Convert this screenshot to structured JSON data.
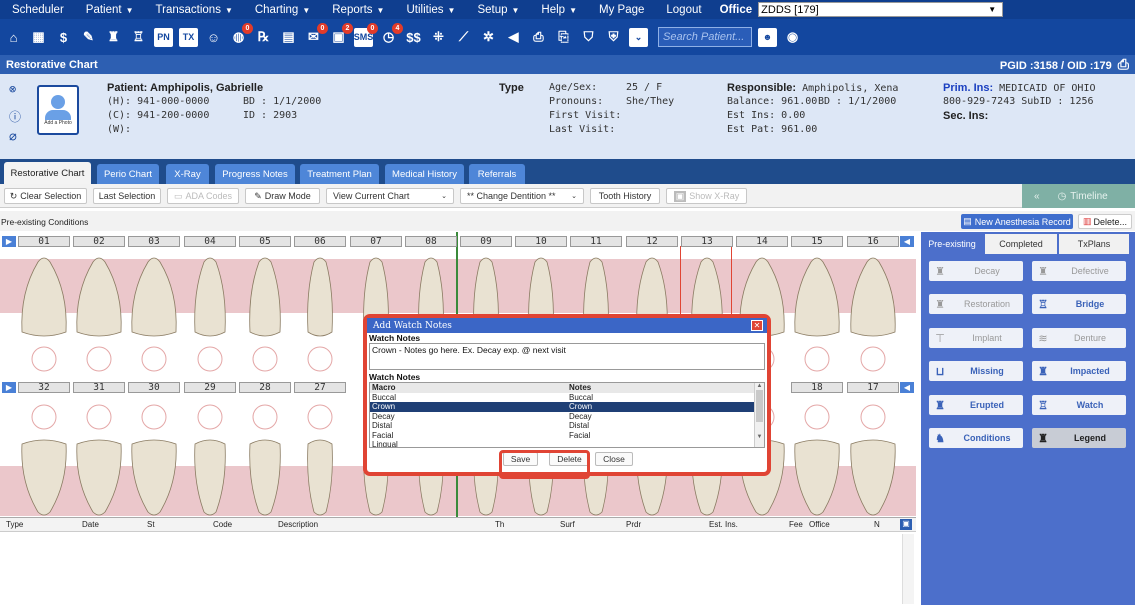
{
  "menubar": {
    "items": [
      "Scheduler",
      "Patient",
      "Transactions",
      "Charting",
      "Reports",
      "Utilities",
      "Setup",
      "Help",
      "My Page",
      "Logout"
    ],
    "office_label": "Office",
    "office_value": "ZDDS [179]"
  },
  "iconbar": {
    "search_placeholder": "Search Patient...",
    "icons": [
      "home-icon",
      "calendar-icon",
      "dollar-icon",
      "pen-icon",
      "tooth-icon",
      "tooth-alt-icon",
      "pn-icon",
      "tx-icon",
      "users-icon",
      "globe-icon",
      "rx-icon",
      "chat-icon",
      "message-icon",
      "ab-icon",
      "sms-icon",
      "clock-icon",
      "money-icon",
      "grid-icon",
      "chart-icon",
      "network-icon",
      "megaphone-icon",
      "printer-icon",
      "print-icon",
      "shield-check-icon",
      "shield-icon",
      "chevron-icon",
      "user-search-icon",
      "eye-search-icon"
    ],
    "badges": {
      "globe": "0",
      "rx": "0",
      "ab": "2",
      "sms": "0",
      "clock": "4"
    }
  },
  "titlebar": {
    "title": "Restorative Chart",
    "ids": "PGID :3158 / OID :179"
  },
  "patient": {
    "name_label": "Patient:",
    "name": "Amphipolis, Gabrielle",
    "home": "(H): 941-000-0000",
    "bd": "BD : 1/1/2000",
    "cell": "(C): 941-200-0000",
    "id": "ID : 2903",
    "work": "(W):",
    "add_photo": "Add a Photo",
    "type_label": "Type",
    "age_label": "Age/Sex:",
    "age_value": "25 / F",
    "pron_label": "Pronouns:",
    "pron_value": "She/They",
    "first_label": "First Visit:",
    "last_label": "Last Visit:",
    "resp_label": "Responsible:",
    "resp_name": "Amphipolis, Xena",
    "balance": "Balance: 961.00",
    "resp_bd": "BD : 1/1/2000",
    "est_ins": "Est Ins:  0.00",
    "est_pat": "Est Pat: 961.00",
    "prim_label": "Prim. Ins:",
    "prim_value": "MEDICAID OF OHIO",
    "prim_phone": "800-929-7243 SubID : 1256",
    "sec_label": "Sec. Ins:"
  },
  "tabs": [
    "Restorative Chart",
    "Perio Chart",
    "X-Ray",
    "Progress Notes",
    "Treatment Plan",
    "Medical History",
    "Referrals"
  ],
  "toolbar": {
    "clear": "Clear Selection",
    "last": "Last Selection",
    "ada": "ADA Codes",
    "draw": "Draw Mode",
    "view": "View Current Chart",
    "dentition": "** Change Dentition **",
    "history": "Tooth History",
    "xray": "Show X-Ray",
    "timeline": "Timeline"
  },
  "condbar": {
    "title": "Pre-existing Conditions",
    "anesthesia": "New Anesthesia Record",
    "delete": "Delete..."
  },
  "teeth_upper": [
    "01",
    "02",
    "03",
    "04",
    "05",
    "06",
    "07",
    "08",
    "09",
    "10",
    "11",
    "12",
    "13",
    "14",
    "15",
    "16"
  ],
  "teeth_lower": [
    "32",
    "31",
    "30",
    "29",
    "28",
    "27",
    "18",
    "17"
  ],
  "side": {
    "tabs": [
      "Pre-existing",
      "Completed",
      "TxPlans"
    ],
    "buttons": [
      "Decay",
      "Defective",
      "Restoration",
      "Bridge",
      "Implant",
      "Denture",
      "Missing",
      "Impacted",
      "Erupted",
      "Watch",
      "Conditions",
      "Legend"
    ]
  },
  "grid": {
    "headers": [
      "Type",
      "Date",
      "St",
      "Code",
      "Description",
      "Th",
      "Surf",
      "Prdr",
      "Est. Ins.",
      "Fee",
      "Office",
      "N"
    ]
  },
  "modal": {
    "title": "Add Watch Notes",
    "notes_label": "Watch Notes",
    "notes_text": "Crown - Notes go here. Ex. Decay exp. @ next visit",
    "list_label": "Watch Notes",
    "col_macro": "Macro",
    "col_notes": "Notes",
    "rows": [
      [
        "Buccal",
        "Buccal"
      ],
      [
        "Crown",
        "Crown"
      ],
      [
        "Decay",
        "Decay"
      ],
      [
        "Distal",
        "Distal"
      ],
      [
        "Facial",
        "Facial"
      ],
      [
        "Lingual",
        ""
      ]
    ],
    "save": "Save",
    "delete": "Delete",
    "close": "Close"
  }
}
